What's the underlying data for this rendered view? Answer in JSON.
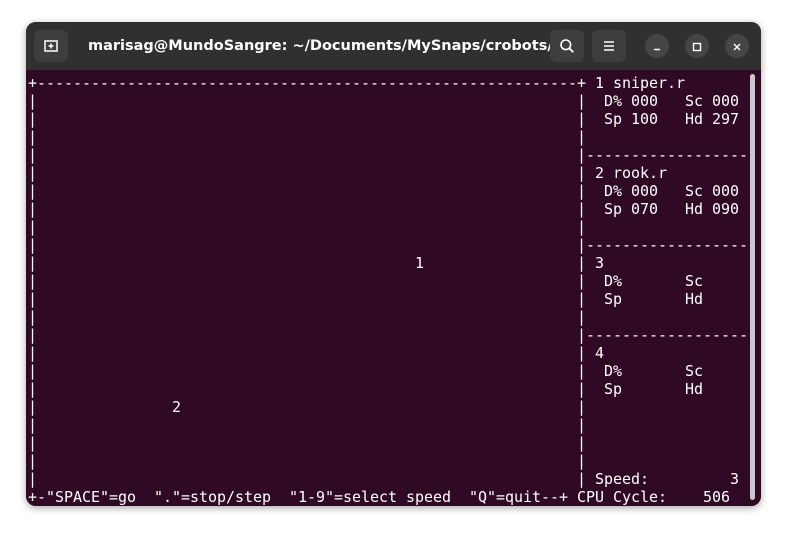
{
  "window": {
    "title": "marisag@MundoSangre: ~/Documents/MySnaps/crobots/src",
    "buttons": {
      "new_tab_icon": "new-tab-icon",
      "search_icon": "search-icon",
      "menu_icon": "hamburger-menu-icon",
      "minimize_icon": "minimize-icon",
      "maximize_icon": "maximize-icon",
      "close_icon": "close-icon"
    }
  },
  "colors": {
    "terminal_bg": "#300a24",
    "titlebar_bg": "#303030",
    "text": "#ffffff"
  },
  "terminal": {
    "lines": [
      "+------------------------------------------------------------+ 1 sniper.r",
      "|                                                            |  D% 000   Sc 000",
      "|                                                            |  Sp 100   Hd 297",
      "|                                                            |",
      "|                                                            |-------------------",
      "|                                                            | 2 rook.r",
      "|                                                            |  D% 000   Sc 000",
      "|                                                            |  Sp 070   Hd 090",
      "|                                                            |",
      "|                                                            |-------------------",
      "|                                          1                 | 3",
      "|                                                            |  D%       Sc",
      "|                                                            |  Sp       Hd",
      "|                                                            |",
      "|                                                            |-------------------",
      "|                                                            | 4",
      "|                                                            |  D%       Sc",
      "|                                                            |  Sp       Hd",
      "|               2                                            |",
      "|                                                            |",
      "|                                                            |",
      "|                                                            |",
      "|                                                            | Speed:         3",
      "+-\"SPACE\"=go  \".\"=stop/step  \"1-9\"=select speed  \"Q\"=quit--+ CPU Cycle:    506"
    ]
  }
}
